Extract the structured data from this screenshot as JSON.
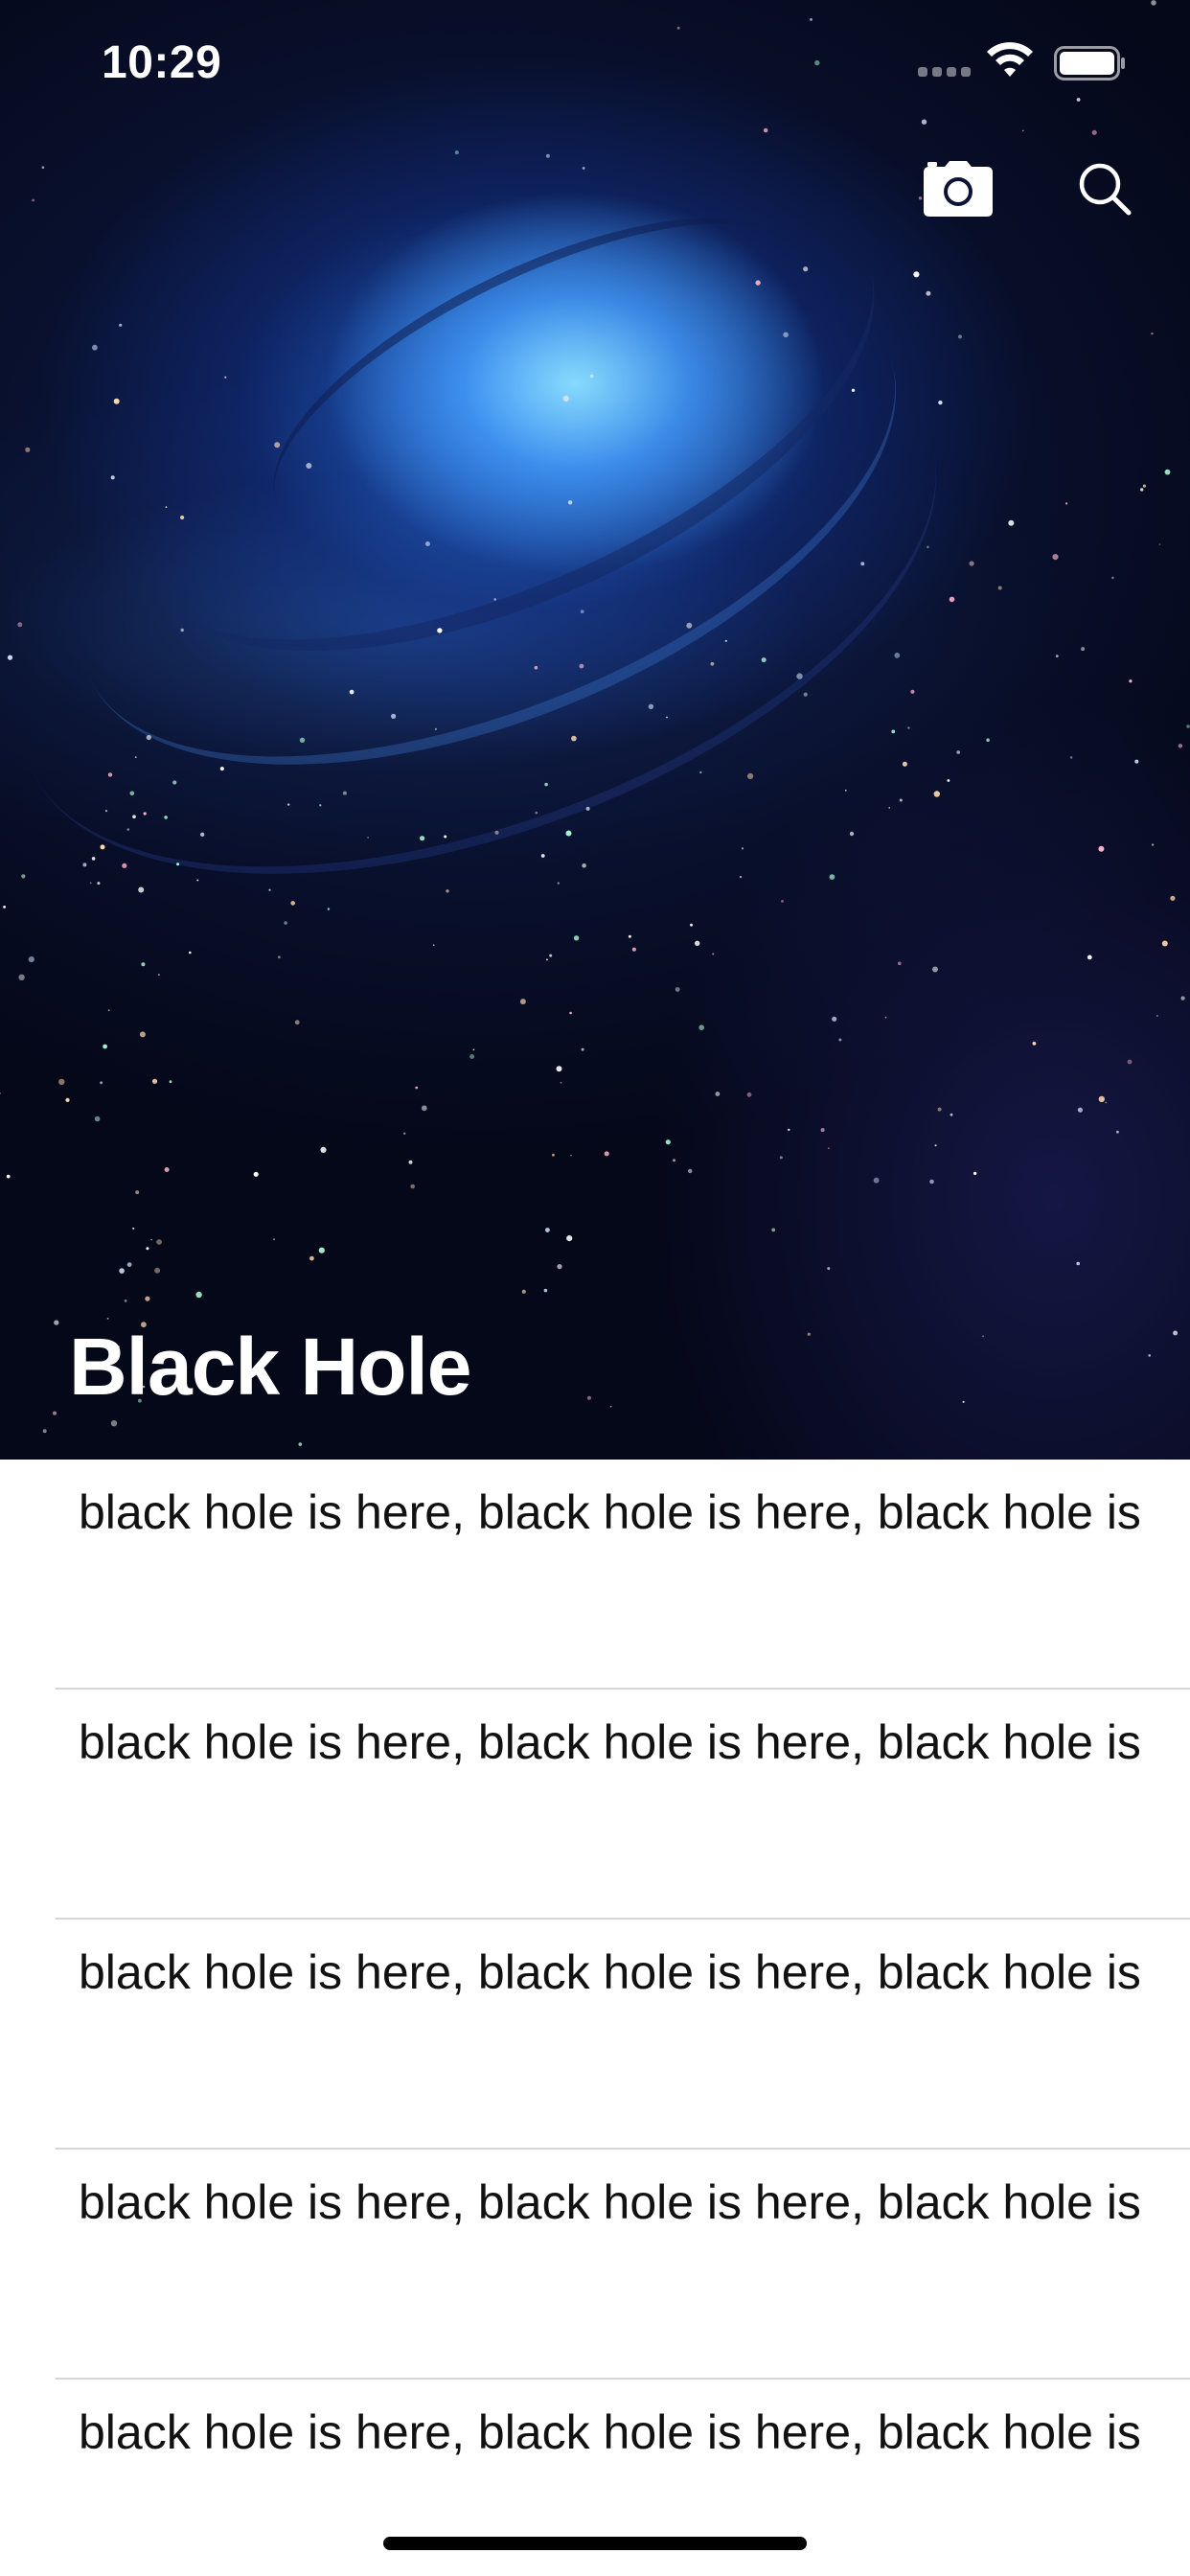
{
  "status_bar": {
    "time": "10:29"
  },
  "header": {
    "title": "Black Hole",
    "icons": {
      "camera": "camera-icon",
      "search": "search-icon"
    }
  },
  "list": {
    "items": [
      {
        "text": "black hole is here, black hole is here,  black hole is"
      },
      {
        "text": "black hole is here, black hole is here,  black hole is"
      },
      {
        "text": "black hole is here, black hole is here,  black hole is"
      },
      {
        "text": "black hole is here, black hole is here,  black hole is"
      },
      {
        "text": "black hole is here, black hole is here,  black hole is"
      }
    ]
  },
  "colors": {
    "header_text": "#ffffff",
    "row_text": "#111111",
    "separator": "#d6d6d9",
    "nebula_core": "#8ce1ff",
    "space_background": "#05070f"
  }
}
